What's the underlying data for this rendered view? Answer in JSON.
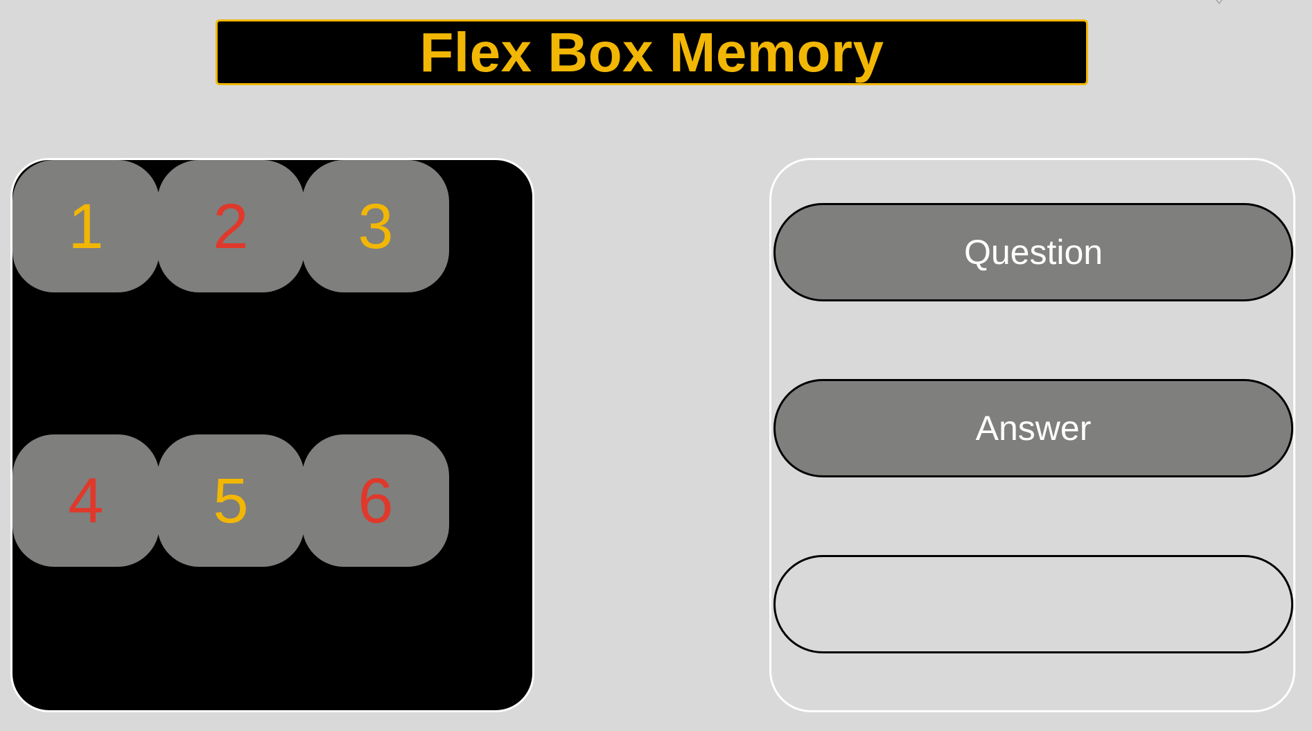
{
  "app": {
    "title": "Flex Box Memory"
  },
  "colors": {
    "background": "#d9d9d9",
    "accent_yellow": "#f2b705",
    "accent_red": "#e0382a",
    "card_gray": "#7f7f7d",
    "board_black": "#000000"
  },
  "cards": [
    {
      "label": "1",
      "color": "#f2b705"
    },
    {
      "label": "2",
      "color": "#e0382a"
    },
    {
      "label": "3",
      "color": "#f2b705"
    },
    {
      "label": "4",
      "color": "#e0382a"
    },
    {
      "label": "5",
      "color": "#f2b705"
    },
    {
      "label": "6",
      "color": "#e0382a"
    }
  ],
  "panel": {
    "question_label": "Question",
    "answer_label": "Answer",
    "response_value": ""
  }
}
